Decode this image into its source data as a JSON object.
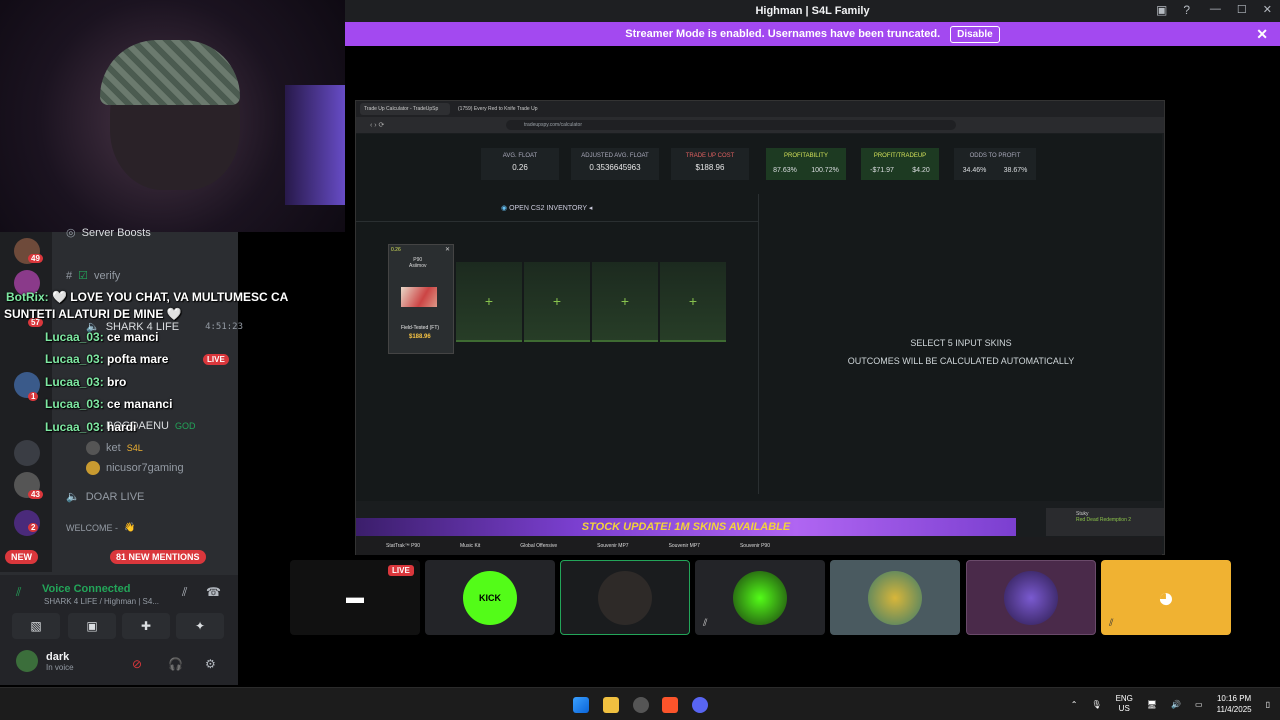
{
  "window": {
    "title": "Highman | S4L Family",
    "minimize": "—",
    "maximize": "☐",
    "close": "✕"
  },
  "streamer_banner": {
    "text": "Streamer Mode is enabled. Usernames have been truncated.",
    "button": "Disable",
    "close": "✕"
  },
  "sidebar": {
    "server_boosts": "Server Boosts",
    "channels": [
      {
        "name": "verify"
      },
      {
        "name": "SHARK 4 LIFE",
        "time": "4:51:23"
      },
      {
        "name": "DOAR LIVE"
      }
    ],
    "voice_users": [
      "BOGDAENU",
      "ket",
      "nicusor7gaming"
    ],
    "god_tag": "GOD",
    "s4l_tag": "S4L",
    "live_badge": "LIVE",
    "category_welcome": "WELCOME -",
    "new_pill": "NEW",
    "mentions_pill": "81 NEW MENTIONS",
    "guild_badges": [
      "49",
      "57",
      "1",
      "43",
      "2"
    ]
  },
  "chat_overlay": [
    {
      "user": "BotRix:",
      "message": "🤍 LOVE YOU CHAT, VA MULTUMESC CA"
    },
    {
      "user": "",
      "message": "SUNTETI ALATURI DE MINE 🤍"
    },
    {
      "user": "Lucaa_03:",
      "message": "ce manci"
    },
    {
      "user": "Lucaa_03:",
      "message": "pofta mare"
    },
    {
      "user": "Lucaa_03:",
      "message": "bro"
    },
    {
      "user": "Lucaa_03:",
      "message": "ce mananci"
    },
    {
      "user": "Lucaa_03:",
      "message": "hardi"
    }
  ],
  "voice_panel": {
    "status": "Voice Connected",
    "channel": "SHARK 4 LIFE / Highman | S4...",
    "username": "dark",
    "user_status": "In voice"
  },
  "shared_screen": {
    "tabs": [
      "Trade Up Calculator - TradeUpSp",
      "(1759) Every Red to Knife Trade Up"
    ],
    "url": "tradeupspy.com/calculator",
    "stats": [
      {
        "label": "AVG. FLOAT",
        "value": "0.26"
      },
      {
        "label": "ADJUSTED AVG. FLOAT",
        "value": "0.3536645963"
      },
      {
        "label": "TRADE UP COST",
        "value": "$188.96"
      },
      {
        "label": "PROFITABILITY",
        "values": [
          "87.63%",
          "100.72%"
        ]
      },
      {
        "label": "PROFIT/TRADEUP",
        "values": [
          "-$71.97",
          "$4.20"
        ]
      },
      {
        "label": "ODDS TO PROFIT",
        "values": [
          "34.46%",
          "38.67%"
        ]
      }
    ],
    "open_inventory": "OPEN CS2 INVENTORY",
    "skin": {
      "float": "0.26",
      "weapon": "P90",
      "name": "Asiimov",
      "wear": "Field-Tested (FT)",
      "price": "$188.96"
    },
    "empty_slot_icon": "+",
    "select_line1": "SELECT 5 INPUT SKINS",
    "select_line2": "OUTCOMES WILL BE CALCULATED AUTOMATICALLY",
    "ad_banner": "STOCK UPDATE!   1M SKINS AVAILABLE",
    "notif_user": "Stuky",
    "notif_game": "Red Dead Redemption 2",
    "taskbar_items": [
      "StatTrak™ P90",
      "Music Kit",
      "Global Offensive",
      "Souvenir MP7",
      "Souvenir MP7",
      "Souvenir P90"
    ]
  },
  "stream_tiles": {
    "live_badge": "LIVE",
    "kick_label": "KICK"
  },
  "taskbar": {
    "lang": "ENG",
    "region": "US",
    "time": "10:16 PM",
    "date": "11/4/2025"
  },
  "colors": {
    "discord_bg": "#2b2d31",
    "streamer_purple": "#a349f0",
    "live_red": "#da373c",
    "voice_green": "#23a559",
    "discord_yellow_tile": "#f0b232"
  }
}
